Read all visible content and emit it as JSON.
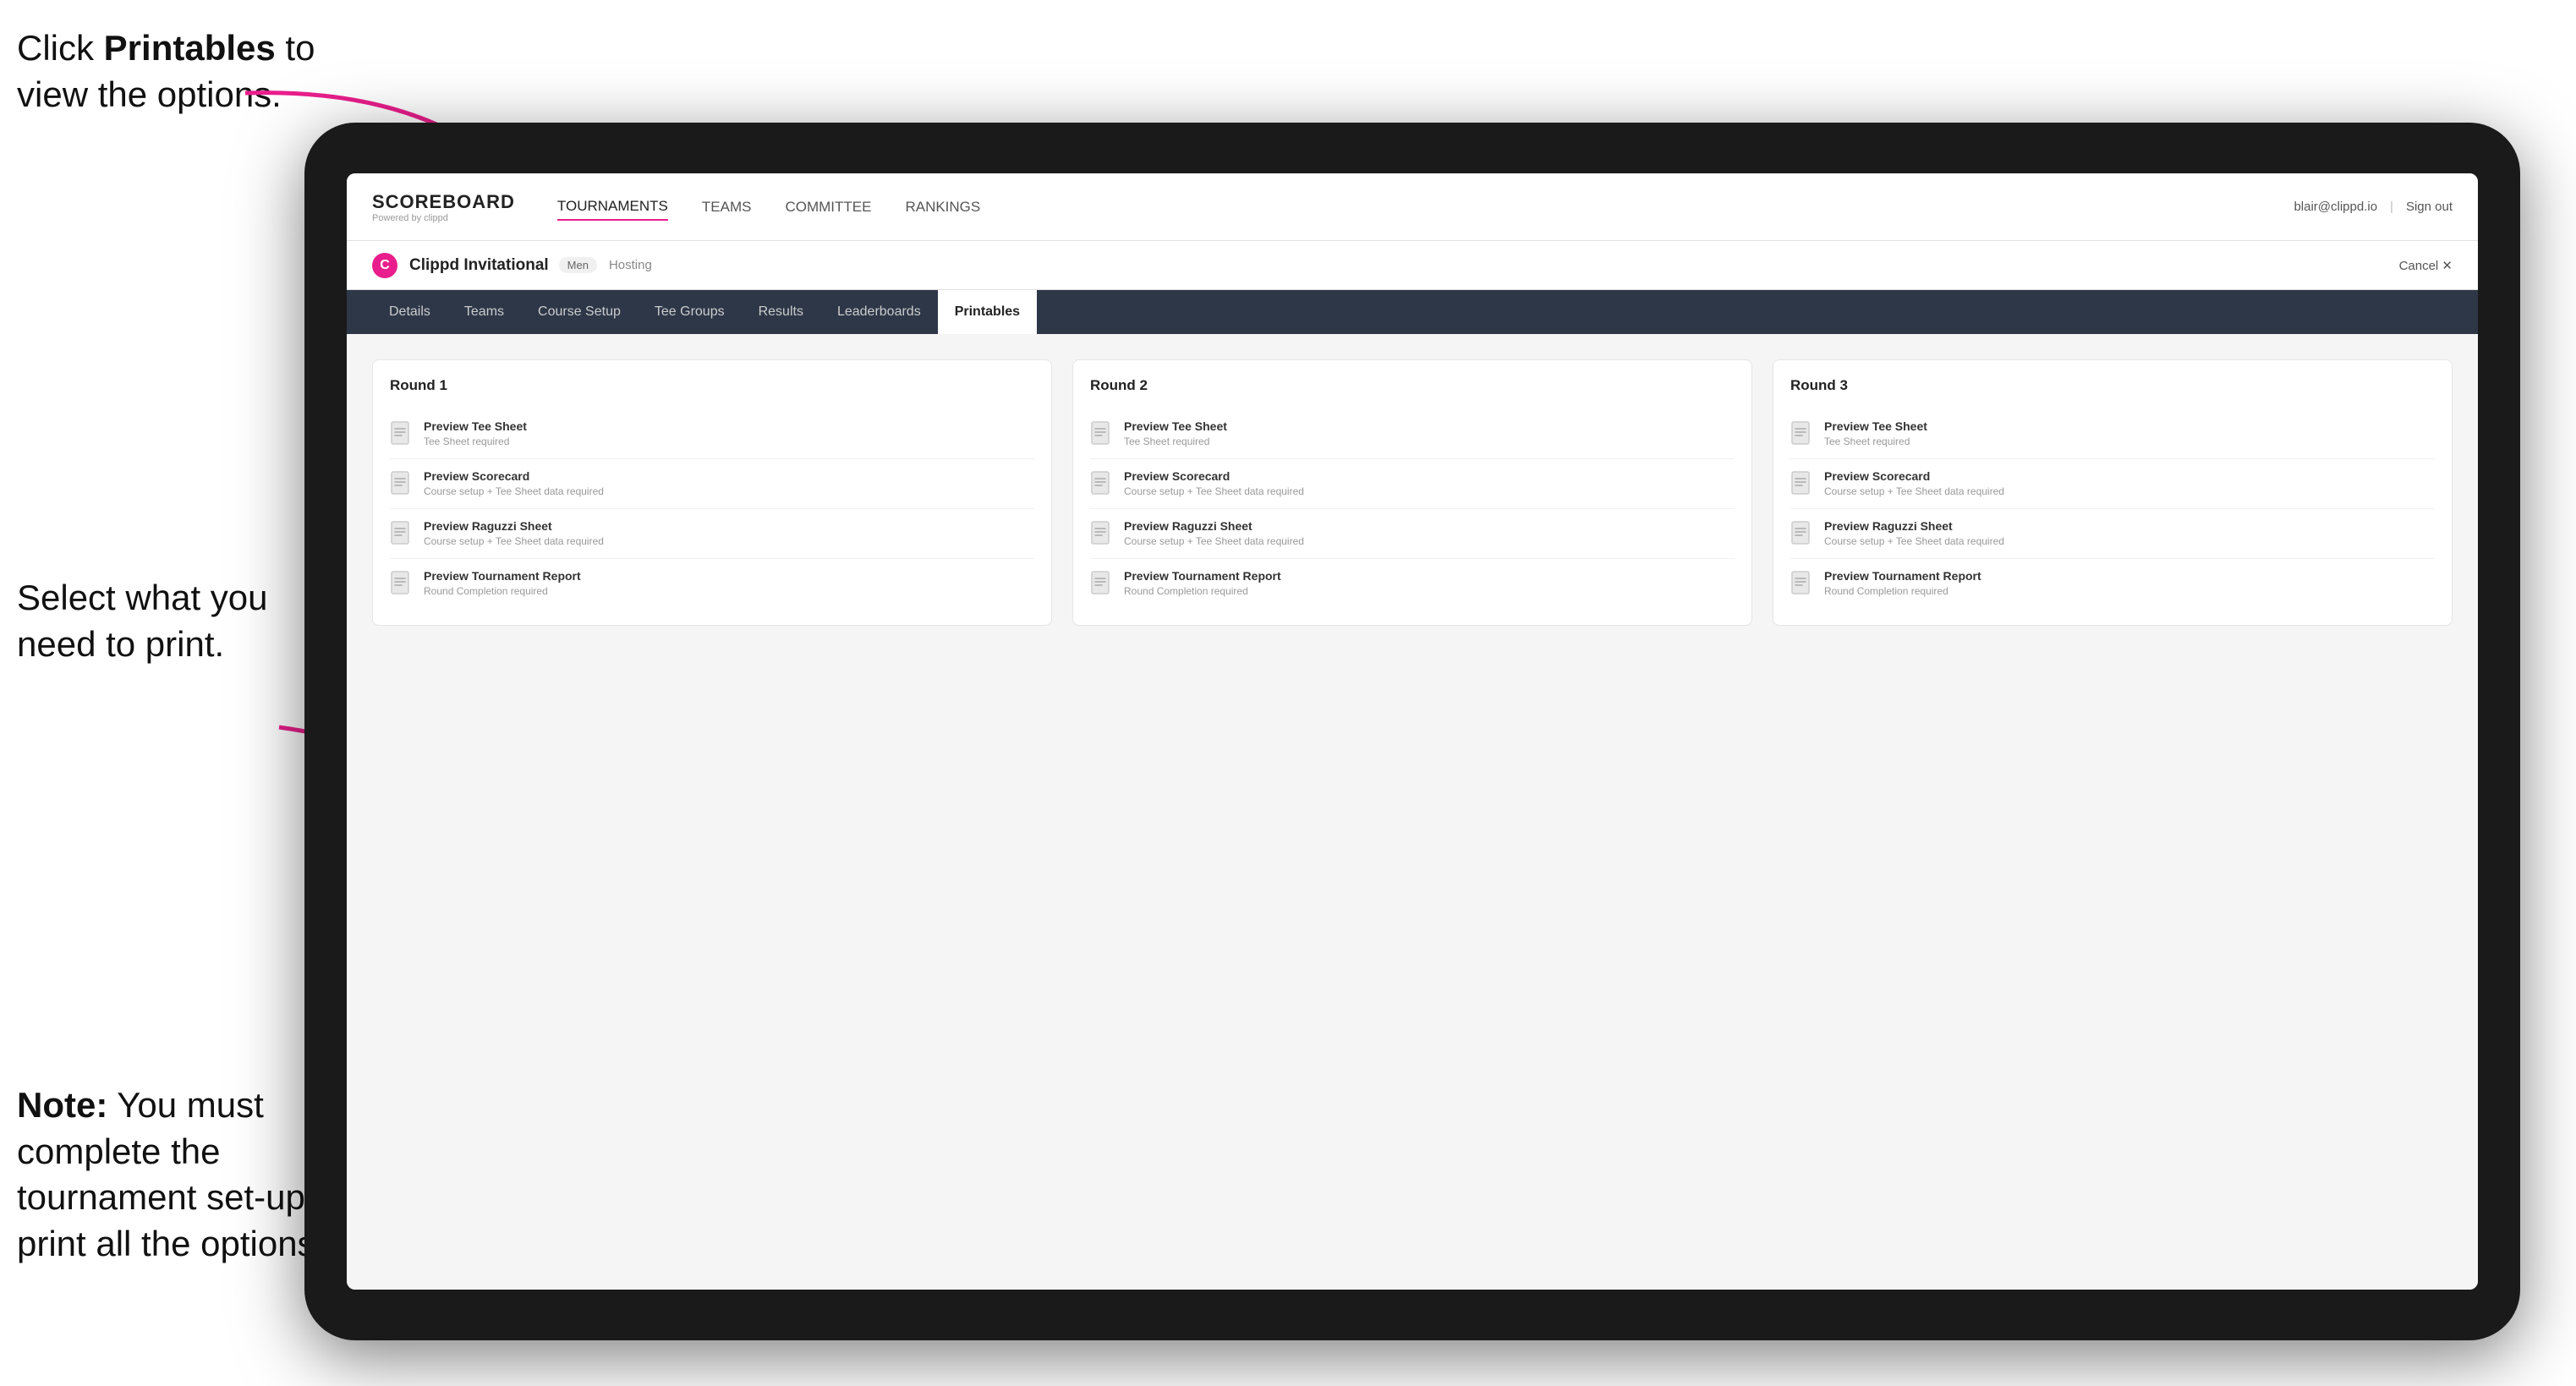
{
  "instructions": {
    "top": "Click ",
    "top_bold": "Printables",
    "top_rest": " to view the options.",
    "middle": "Select what you need to print.",
    "bottom_bold": "Note:",
    "bottom_rest": " You must complete the tournament set-up to print all the options."
  },
  "nav": {
    "brand_title": "SCOREBOARD",
    "brand_sub": "Powered by clippd",
    "links": [
      "TOURNAMENTS",
      "TEAMS",
      "COMMITTEE",
      "RANKINGS"
    ],
    "user": "blair@clippd.io",
    "sign_out": "Sign out"
  },
  "sub_header": {
    "icon": "C",
    "tournament": "Clippd Invitational",
    "badge": "Men",
    "hosting": "Hosting",
    "cancel": "Cancel ✕"
  },
  "tabs": [
    "Details",
    "Teams",
    "Course Setup",
    "Tee Groups",
    "Results",
    "Leaderboards",
    "Printables"
  ],
  "active_tab": "Printables",
  "rounds": [
    {
      "title": "Round 1",
      "items": [
        {
          "title": "Preview Tee Sheet",
          "sub": "Tee Sheet required"
        },
        {
          "title": "Preview Scorecard",
          "sub": "Course setup + Tee Sheet data required"
        },
        {
          "title": "Preview Raguzzi Sheet",
          "sub": "Course setup + Tee Sheet data required"
        },
        {
          "title": "Preview Tournament Report",
          "sub": "Round Completion required"
        }
      ]
    },
    {
      "title": "Round 2",
      "items": [
        {
          "title": "Preview Tee Sheet",
          "sub": "Tee Sheet required"
        },
        {
          "title": "Preview Scorecard",
          "sub": "Course setup + Tee Sheet data required"
        },
        {
          "title": "Preview Raguzzi Sheet",
          "sub": "Course setup + Tee Sheet data required"
        },
        {
          "title": "Preview Tournament Report",
          "sub": "Round Completion required"
        }
      ]
    },
    {
      "title": "Round 3",
      "items": [
        {
          "title": "Preview Tee Sheet",
          "sub": "Tee Sheet required"
        },
        {
          "title": "Preview Scorecard",
          "sub": "Course setup + Tee Sheet data required"
        },
        {
          "title": "Preview Raguzzi Sheet",
          "sub": "Course setup + Tee Sheet data required"
        },
        {
          "title": "Preview Tournament Report",
          "sub": "Round Completion required"
        }
      ]
    }
  ]
}
